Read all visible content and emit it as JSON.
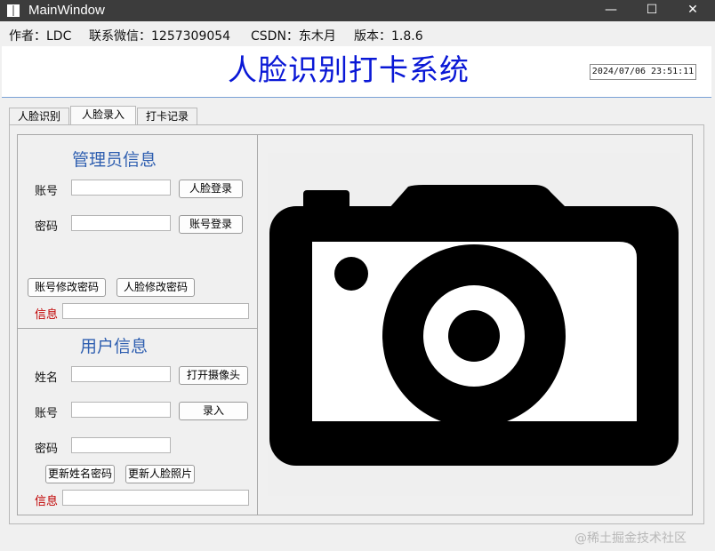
{
  "window": {
    "title": "MainWindow",
    "minimize_glyph": "—",
    "maximize_glyph": "☐",
    "close_glyph": "✕"
  },
  "infobar": {
    "author": "作者：LDC",
    "wechat": "联系微信：1257309054",
    "csdn": "CSDN：东木月",
    "version": "版本：1.8.6"
  },
  "header": {
    "title": "人脸识别打卡系统",
    "datetime": "2024/07/06 23:51:11"
  },
  "tabs": [
    {
      "label": "人脸识别"
    },
    {
      "label": "人脸录入"
    },
    {
      "label": "打卡记录"
    }
  ],
  "admin": {
    "title": "管理员信息",
    "account_label": "账号",
    "password_label": "密码",
    "face_login_btn": "人脸登录",
    "account_login_btn": "账号登录",
    "change_pwd_btn": "账号修改密码",
    "face_change_pwd_btn": "人脸修改密码",
    "info_label": "信息"
  },
  "user": {
    "title": "用户信息",
    "name_label": "姓名",
    "account_label": "账号",
    "password_label": "密码",
    "open_camera_btn": "打开摄像头",
    "enroll_btn": "录入",
    "update_name_pwd_btn": "更新姓名密码",
    "update_face_btn": "更新人脸照片",
    "info_label": "信息"
  },
  "camera": {
    "icon": "camera-icon"
  },
  "watermark": "@稀土掘金技术社区",
  "colors": {
    "titlebar": "#3c3c3c",
    "main_title": "#0a18d6",
    "group_title": "#2f5fb0",
    "info_label": "#c00000"
  }
}
